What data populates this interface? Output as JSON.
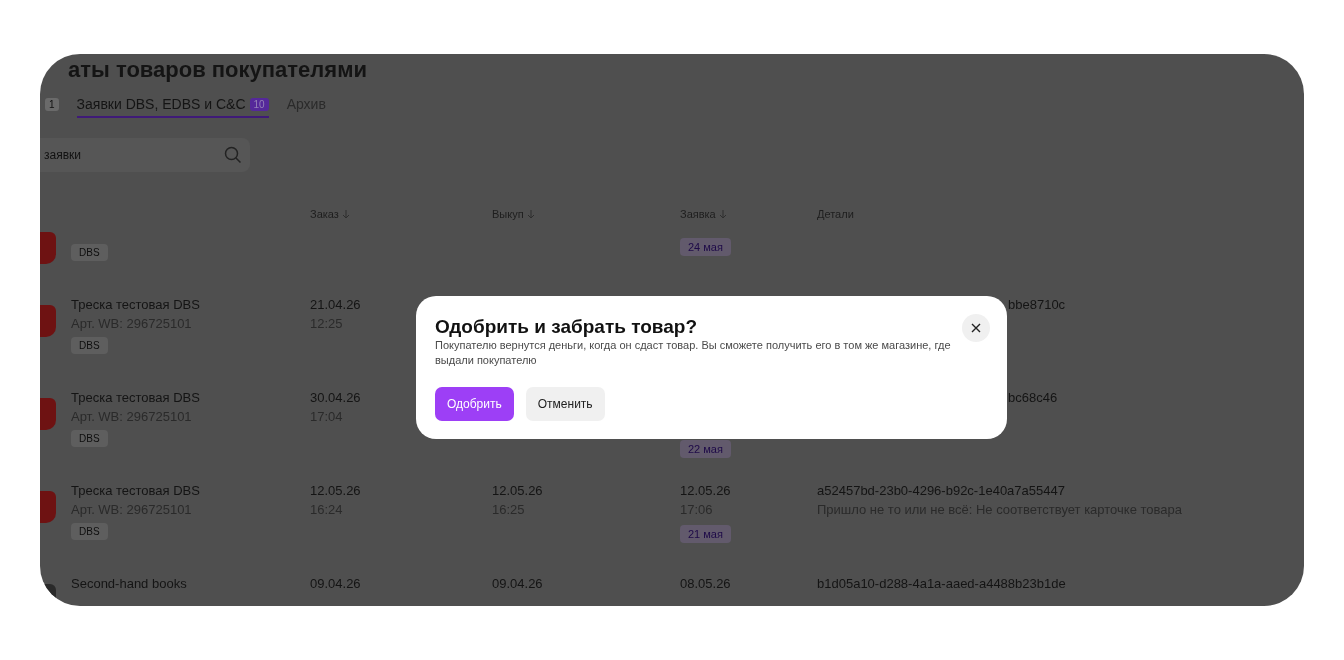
{
  "page": {
    "title": "аты товаров покупателями",
    "tabs": [
      {
        "count": "1",
        "selected": false
      },
      {
        "label": "Заявки DBS, EDBS и C&C",
        "count": "10",
        "selected": true
      },
      {
        "label": "Архив",
        "selected": false
      }
    ],
    "search": {
      "placeholder": "заявки"
    },
    "table": {
      "columns": [
        {
          "label": "Заказ",
          "sorted": true
        },
        {
          "label": "Выкуп",
          "sorted": true
        },
        {
          "label": "Заявка",
          "sorted": true
        },
        {
          "label": "Детали",
          "sorted": false
        }
      ],
      "rows": [
        {
          "color": "#6e1212",
          "tag": "DBS",
          "deadline": "24 мая"
        },
        {
          "color": "#6e1212",
          "name": "Треска тестовая DBS",
          "article": "Арт. WB: 296725101",
          "tag": "DBS",
          "order_date": "21.04.26",
          "order_time": "12:25",
          "details_visible_tail": "bbe8710c"
        },
        {
          "color": "#6e1212",
          "name": "Треска тестовая DBS",
          "article": "Арт. WB: 296725101",
          "tag": "DBS",
          "order_date": "30.04.26",
          "order_time": "17:04",
          "deadline": "22 мая",
          "details_visible_tail": "bc68c46"
        },
        {
          "color": "#6e1212",
          "name": "Треска тестовая DBS",
          "article": "Арт. WB: 296725101",
          "tag": "DBS",
          "order_date": "12.05.26",
          "order_time": "16:24",
          "buyout_date": "12.05.26",
          "buyout_time": "16:25",
          "request_date": "12.05.26",
          "request_time": "17:06",
          "deadline": "21 мая",
          "details_id": "a52457bd-23b0-4296-b92c-1e40a7a55447",
          "details_reason": "Пришло не то или не всё: Не соответствует карточке товара"
        },
        {
          "color": "#2a2a2a",
          "name": "Second-hand books",
          "order_date": "09.04.26",
          "buyout_date": "09.04.26",
          "request_date": "08.05.26",
          "details_id": "b1d05a10-d288-4a1a-aaed-a4488b23b1de"
        }
      ]
    }
  },
  "dialog": {
    "title": "Одобрить и забрать товар?",
    "text": "Покупателю вернутся деньги, когда он сдаст товар. Вы сможете получить его в том же магазине, где выдали покупателю",
    "buttons": [
      {
        "label": "Одобрить",
        "kind": "primary"
      },
      {
        "label": "Отменить",
        "kind": "secondary"
      }
    ]
  }
}
